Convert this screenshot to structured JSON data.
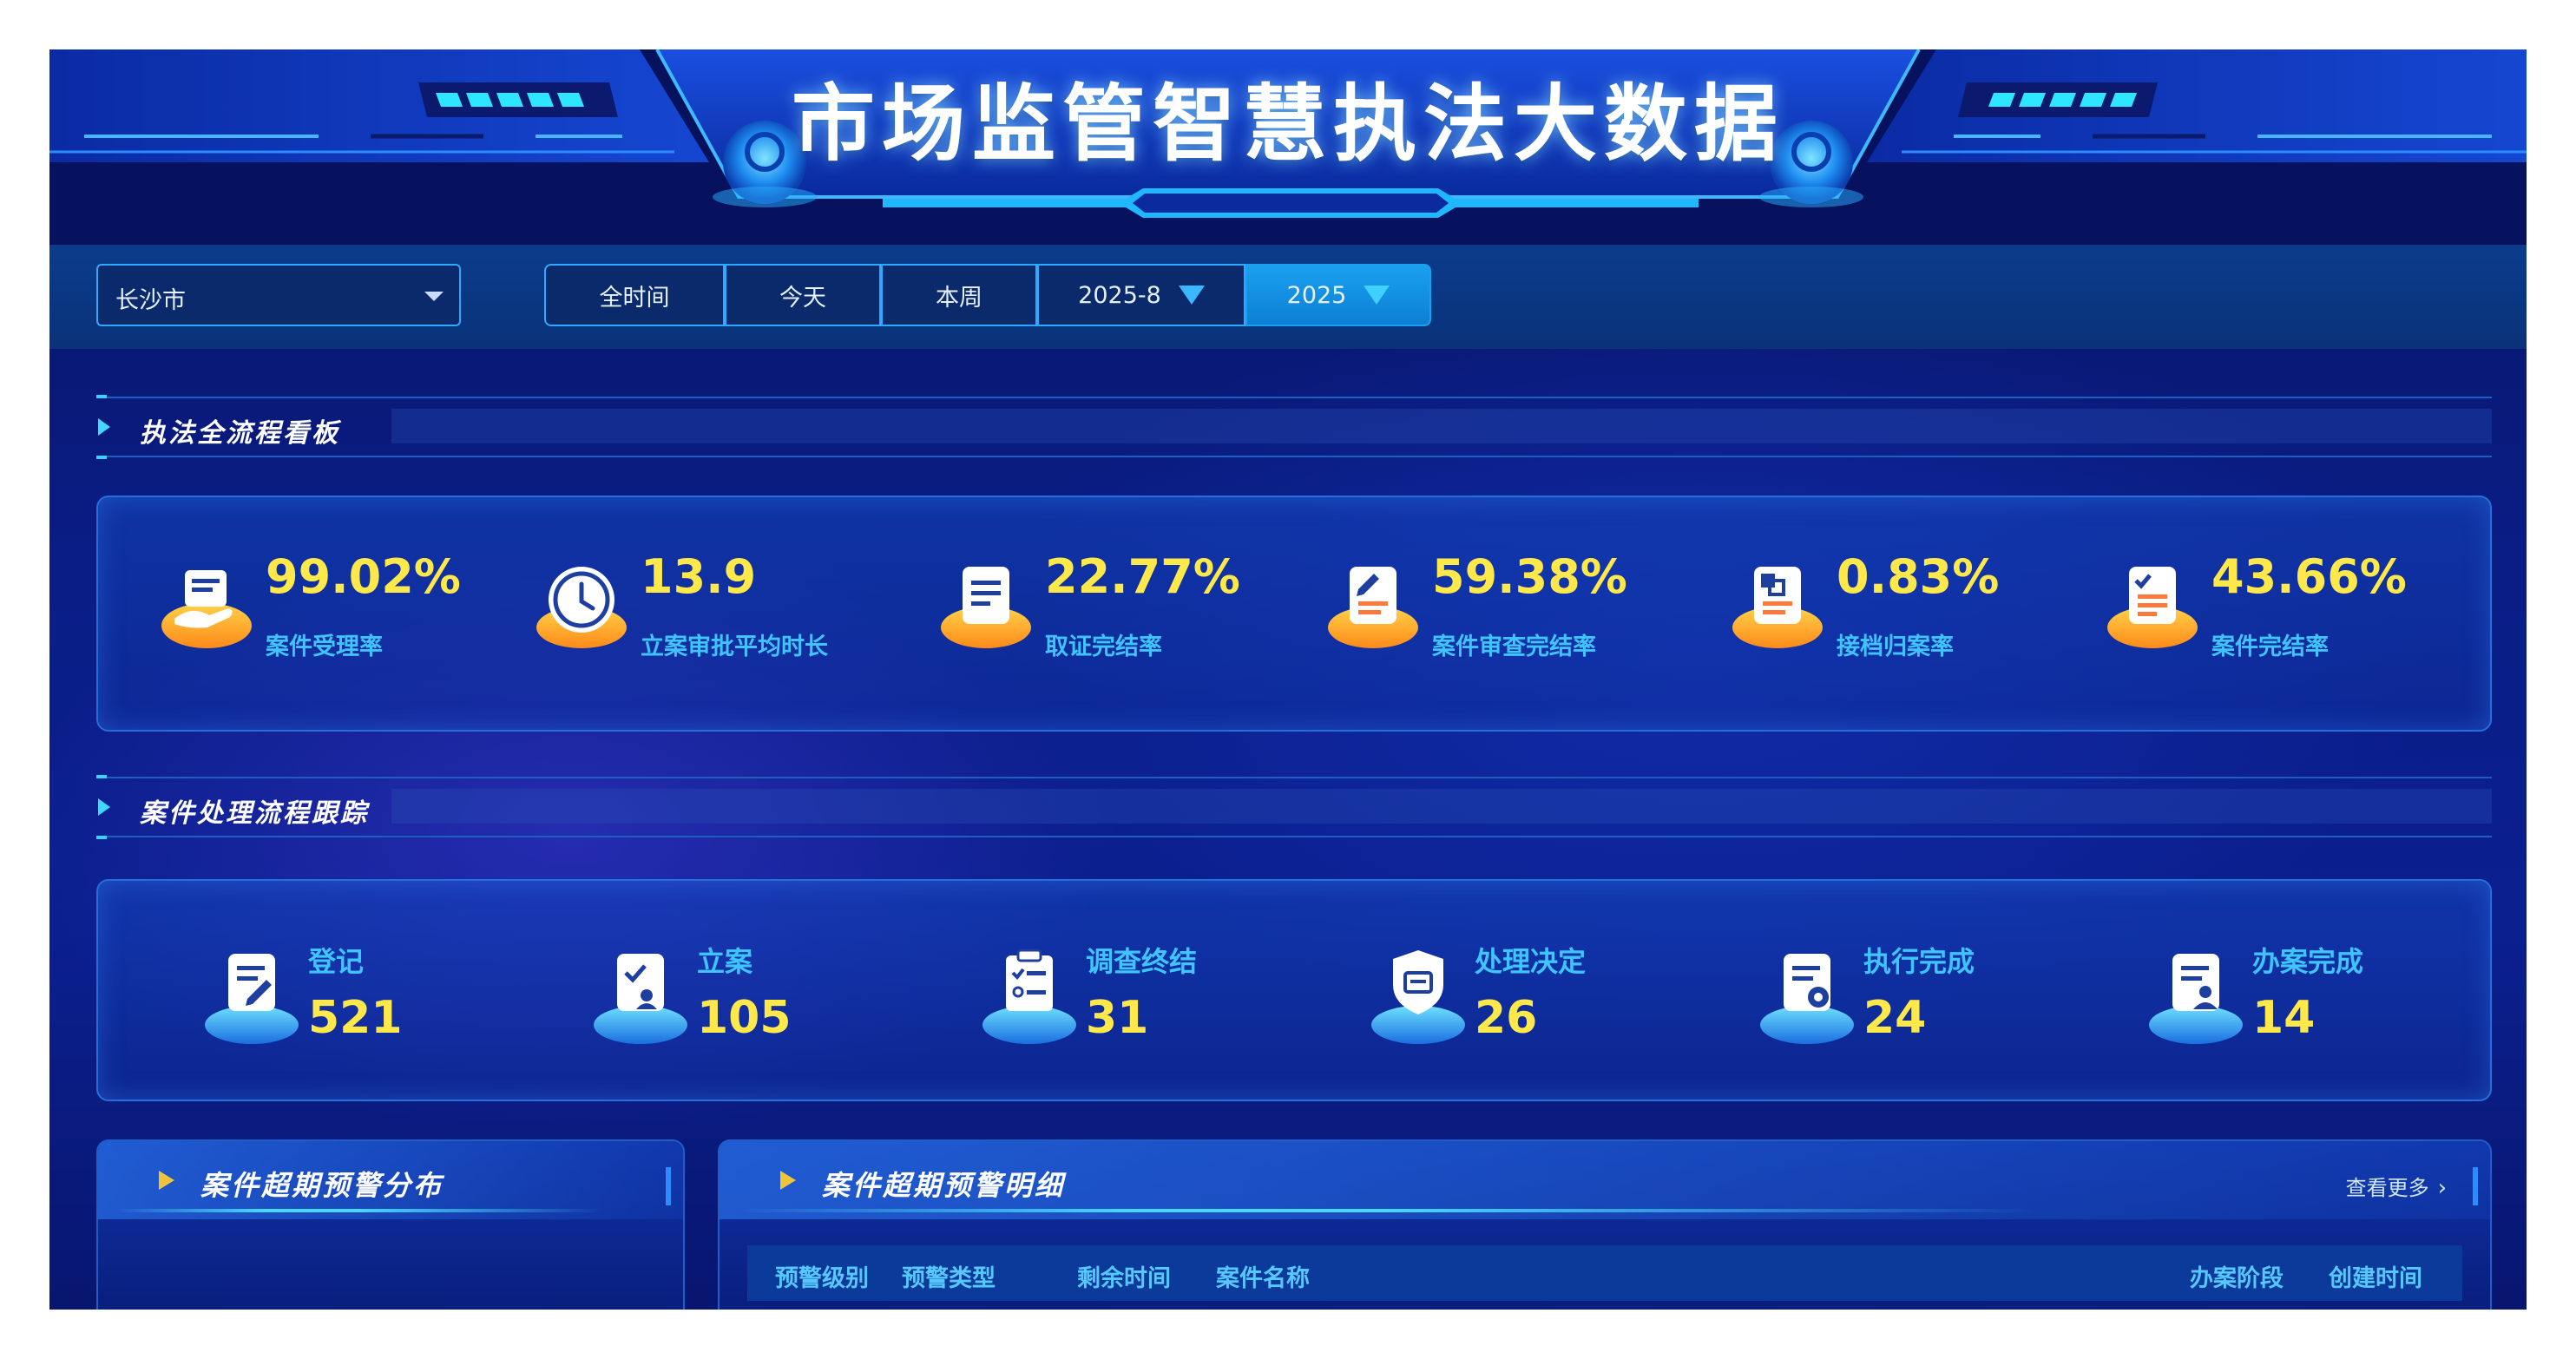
{
  "header": {
    "title": "市场监管智慧执法大数据"
  },
  "filters": {
    "city": "长沙市",
    "time_tabs": [
      {
        "label": "全时间",
        "dropdown": false,
        "active": false
      },
      {
        "label": "今天",
        "dropdown": false,
        "active": false
      },
      {
        "label": "本周",
        "dropdown": false,
        "active": false
      },
      {
        "label": "2025-8",
        "dropdown": true,
        "active": false
      },
      {
        "label": "2025",
        "dropdown": true,
        "active": true
      }
    ]
  },
  "section_dashboard": {
    "title": "执法全流程看板",
    "kpis": [
      {
        "value": "99.02%",
        "label": "案件受理率",
        "icon": "case-accept-icon"
      },
      {
        "value": "13.9",
        "label": "立案审批平均时长",
        "icon": "clock-icon"
      },
      {
        "value": "22.77%",
        "label": "取证完结率",
        "icon": "evidence-doc-icon"
      },
      {
        "value": "59.38%",
        "label": "案件审查完结率",
        "icon": "review-doc-icon"
      },
      {
        "value": "0.83%",
        "label": "接档归案率",
        "icon": "archive-doc-icon"
      },
      {
        "value": "43.66%",
        "label": "案件完结率",
        "icon": "checklist-doc-icon"
      }
    ]
  },
  "section_flow": {
    "title": "案件处理流程跟踪",
    "steps": [
      {
        "label": "登记",
        "value": "521",
        "icon": "register-icon"
      },
      {
        "label": "立案",
        "value": "105",
        "icon": "file-case-icon"
      },
      {
        "label": "调查终结",
        "value": "31",
        "icon": "investigation-icon"
      },
      {
        "label": "处理决定",
        "value": "26",
        "icon": "penalty-shield-icon"
      },
      {
        "label": "执行完成",
        "value": "24",
        "icon": "execution-icon"
      },
      {
        "label": "办案完成",
        "value": "14",
        "icon": "case-complete-icon"
      }
    ]
  },
  "warning_distribution": {
    "title": "案件超期预警分布"
  },
  "warning_detail": {
    "title": "案件超期预警明细",
    "more": "查看更多",
    "columns": [
      "预警级别",
      "预警类型",
      "剩余时间",
      "案件名称",
      "办案阶段",
      "创建时间"
    ]
  },
  "colors": {
    "background": "#0a1d86",
    "accent_cyan": "#3fc4ff",
    "value_yellow": "#ffe94a",
    "icon_orange": "#ff9a1e"
  }
}
